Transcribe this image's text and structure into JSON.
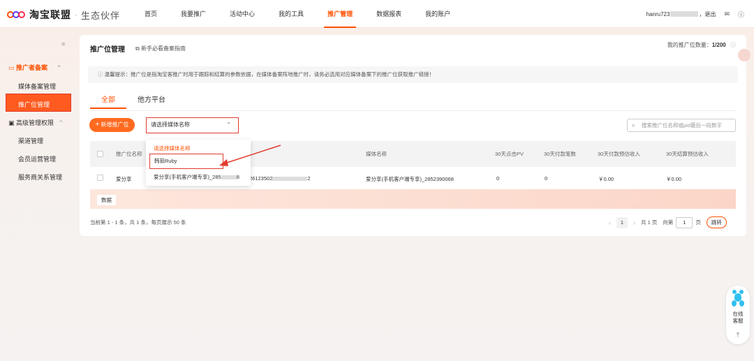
{
  "brand": {
    "name": "淘宝联盟",
    "sep": "·",
    "sub": "生态伙伴"
  },
  "nav": [
    "首页",
    "我要推广",
    "活动中心",
    "我的工具",
    "推广管理",
    "数据报表",
    "我的账户"
  ],
  "nav_active_index": 4,
  "user": {
    "name_prefix": "hanru723",
    "logout": "，退出"
  },
  "sidebar": {
    "group1": "推广者备案",
    "items1": [
      "媒体备案管理",
      "推广位管理"
    ],
    "group2": "高级管理权限",
    "items2": [
      "渠道管理",
      "会员运营管理",
      "服务商关系管理"
    ]
  },
  "card": {
    "title": "推广位管理",
    "guide": "新手必看备案指南",
    "count_label": "我的推广位数量：",
    "count_value": "1/200"
  },
  "tip": "温馨提示：推广位是指淘宝客推广时用于跟踪和结算的参数依据，在媒体备案阵地推广时，请务必选用对应媒体备案下的推广位获取推广链接！",
  "tabs": [
    "全部",
    "他方平台"
  ],
  "toolbar": {
    "add_label": "新增推广位",
    "select_placeholder": "请选择媒体名称",
    "search_placeholder": "搜索推广位名称或pid最后一段数字"
  },
  "table": {
    "headers": [
      "推广位名称",
      "媒体名称",
      "30天点击PV",
      "30天付款笔数",
      "30天付款预估收入",
      "30天结算预估收入"
    ],
    "row": {
      "name": "爱分享",
      "pid_prefix": "26123502",
      "pid_suffix": "2",
      "media": "爱分享(手机客户端专享)_2852390068",
      "pv": "0",
      "orders": "0",
      "income_pay": "￥0.00",
      "income_settle": "￥0.00"
    },
    "data_tag": "数据"
  },
  "footer": {
    "info": "当前第 1 - 1 条，共 1 条，每页展示 50 条",
    "current_page": "1",
    "total_pages": "共 1 页",
    "goto_label": "向第",
    "goto_value": "1",
    "page_unit": "页",
    "jump": "跳转"
  },
  "dropdown": {
    "title": "请选择媒体名称",
    "option1": "韩茹Ruby",
    "option2_prefix": "爱分享(手机客户端专享)_285",
    "option2_suffix": "8"
  },
  "cs": {
    "line1": "在线",
    "line2": "客服"
  },
  "colors": {
    "accent": "#ff5000",
    "highlight_border": "#e23b2e"
  }
}
